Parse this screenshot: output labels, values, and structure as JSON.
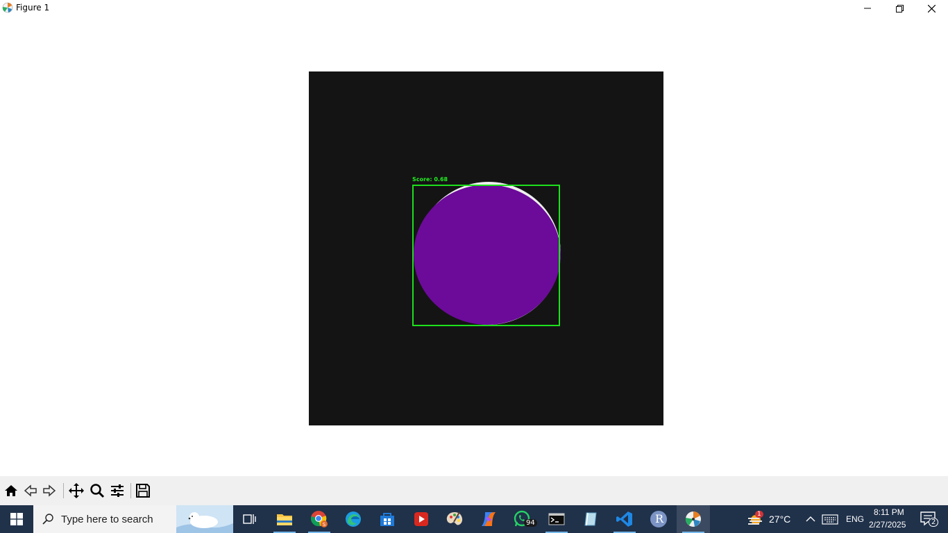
{
  "window": {
    "title": "Figure 1",
    "controls": {
      "minimize_icon": "minimize-icon",
      "maximize_icon": "restore-icon",
      "close_icon": "close-icon"
    }
  },
  "figure": {
    "score_label": "Score: 0.68",
    "colors": {
      "background": "#141414",
      "mask": "#6c0a9a",
      "box": "#1de01d"
    }
  },
  "toolbar": {
    "buttons": [
      {
        "name": "home",
        "icon": "home-icon"
      },
      {
        "name": "back",
        "icon": "back-arrow-icon"
      },
      {
        "name": "forward",
        "icon": "forward-arrow-icon"
      },
      {
        "name": "pan",
        "icon": "pan-icon"
      },
      {
        "name": "zoom",
        "icon": "zoom-icon"
      },
      {
        "name": "configure",
        "icon": "sliders-icon"
      },
      {
        "name": "save",
        "icon": "save-icon"
      }
    ]
  },
  "taskbar": {
    "search_placeholder": "Type here to search",
    "apps": [
      {
        "name": "task-view",
        "icon": "task-view-icon"
      },
      {
        "name": "file-explorer",
        "icon": "folder-icon"
      },
      {
        "name": "chrome",
        "icon": "chrome-icon"
      },
      {
        "name": "edge",
        "icon": "edge-icon"
      },
      {
        "name": "store",
        "icon": "store-icon"
      },
      {
        "name": "media",
        "icon": "play-icon"
      },
      {
        "name": "paint",
        "icon": "paint-icon"
      },
      {
        "name": "copilot",
        "icon": "copilot-icon"
      },
      {
        "name": "whatsapp",
        "icon": "whatsapp-icon",
        "badge": "94"
      },
      {
        "name": "terminal",
        "icon": "terminal-icon"
      },
      {
        "name": "notes",
        "icon": "notes-icon"
      },
      {
        "name": "vscode",
        "icon": "vscode-icon"
      },
      {
        "name": "r",
        "icon": "r-icon",
        "label": "R"
      },
      {
        "name": "matplotlib",
        "icon": "matplotlib-icon"
      }
    ],
    "tray": {
      "weather_badge": "1",
      "temperature": "27°C",
      "language": "ENG",
      "time": "8:11 PM",
      "date": "2/27/2025",
      "notifications": "2"
    }
  }
}
